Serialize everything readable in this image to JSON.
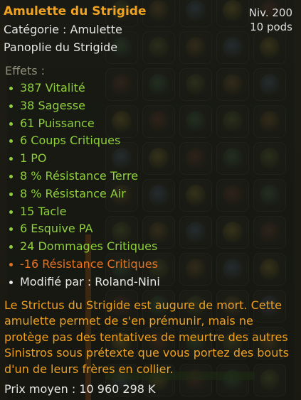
{
  "colors": {
    "title": "#f2a21e",
    "bonus": "#8fd03a",
    "malus": "#e8731e",
    "description": "#efa01e",
    "muted": "#8e8e78",
    "text": "#e8e8e8"
  },
  "item": {
    "name": "Amulette du Strigide",
    "level": "Niv. 200",
    "weight": "10 pods",
    "category": "Catégorie : Amulette",
    "set": "Panoplie du Strigide"
  },
  "effects_header": "Effets :",
  "effects": [
    {
      "text": "387 Vitalité",
      "kind": "bonus"
    },
    {
      "text": "38 Sagesse",
      "kind": "bonus"
    },
    {
      "text": "61 Puissance",
      "kind": "bonus"
    },
    {
      "text": "6 Coups Critiques",
      "kind": "bonus"
    },
    {
      "text": "1 PO",
      "kind": "bonus"
    },
    {
      "text": "8 % Résistance Terre",
      "kind": "bonus"
    },
    {
      "text": "8 % Résistance Air",
      "kind": "bonus"
    },
    {
      "text": "15 Tacle",
      "kind": "bonus"
    },
    {
      "text": "6 Esquive PA",
      "kind": "bonus"
    },
    {
      "text": "24 Dommages Critiques",
      "kind": "bonus"
    },
    {
      "text": "-16 Résistance Critiques",
      "kind": "malus"
    }
  ],
  "modified_by": "Modifié par : Roland-Nini",
  "description": "Le Strictus du Strigide est augure de mort. Cette amulette permet de s'en prémunir, mais ne protège pas des tentatives de meurtre des autres Sinistros sous prétexte que vous portez des bouts d'un de leurs frères en collier.",
  "average_price": "Prix moyen : 10 960 298 K"
}
